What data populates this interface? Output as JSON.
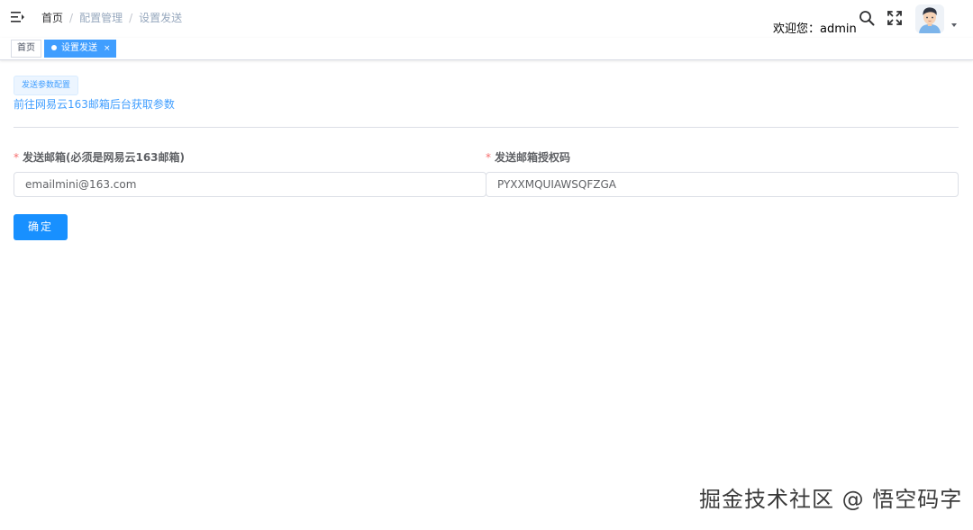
{
  "navbar": {
    "breadcrumb": [
      "首页",
      "配置管理",
      "设置发送"
    ],
    "breadcrumb_separator": "/",
    "welcome_text": "欢迎您：admin"
  },
  "tags_view": {
    "home_tag": "首页",
    "active_tag": "设置发送",
    "close_glyph": "×"
  },
  "content": {
    "config_tag": "发送参数配置",
    "config_link": "前往网易云163邮箱后台获取参数",
    "required_mark": "*",
    "email_label": "发送邮箱(必须是网易云163邮箱)",
    "email_value": "emailmini@163.com",
    "auth_code_label": "发送邮箱授权码",
    "auth_code_value": "PYXXMQUIAWSQFZGA",
    "confirm_button": "确定"
  },
  "watermark": "掘金技术社区 @ 悟空码字",
  "colors": {
    "primary": "#409eff",
    "button": "#1890ff",
    "required": "#f56c6c"
  },
  "icons": [
    "hamburger-icon",
    "search-icon",
    "fullscreen-icon",
    "avatar",
    "caret-down-icon",
    "close-icon"
  ]
}
